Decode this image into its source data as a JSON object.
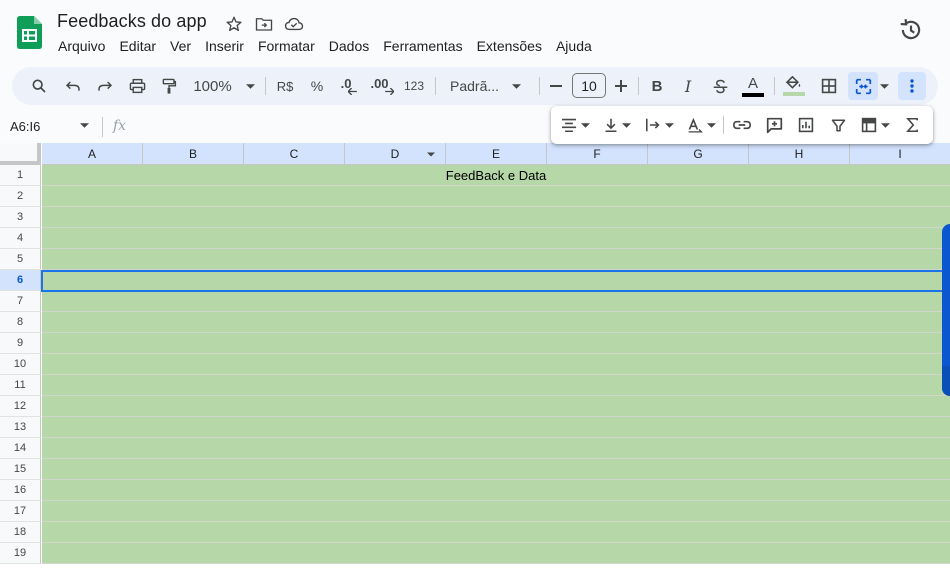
{
  "doc": {
    "title": "Feedbacks do app"
  },
  "menu": [
    "Arquivo",
    "Editar",
    "Ver",
    "Inserir",
    "Formatar",
    "Dados",
    "Ferramentas",
    "Extensões",
    "Ajuda"
  ],
  "toolbar": {
    "zoom": "100%",
    "currency": "R$",
    "percent": "%",
    "dec_decrease": ".0",
    "dec_increase": ".00",
    "more_formats": "123",
    "font": "Padrã...",
    "font_size": "10",
    "bold": "B",
    "italic": "I",
    "text_color_letter": "A"
  },
  "formula_bar": {
    "name_box": "A6:I6",
    "fx": "fx"
  },
  "grid": {
    "columns": [
      "A",
      "B",
      "C",
      "D",
      "E",
      "F",
      "G",
      "H",
      "I"
    ],
    "rows": [
      "1",
      "2",
      "3",
      "4",
      "5",
      "6",
      "7",
      "8",
      "9",
      "10",
      "11",
      "12",
      "13",
      "14",
      "15",
      "16",
      "17",
      "18",
      "19"
    ],
    "selected_row": "6",
    "merged_cell_text": "FeedBack e Data"
  },
  "colors": {
    "fill": "#b6d7a8",
    "selection": "#1a73e8",
    "header_selected": "#d3e3fd",
    "sheets_green": "#0f9d58"
  }
}
